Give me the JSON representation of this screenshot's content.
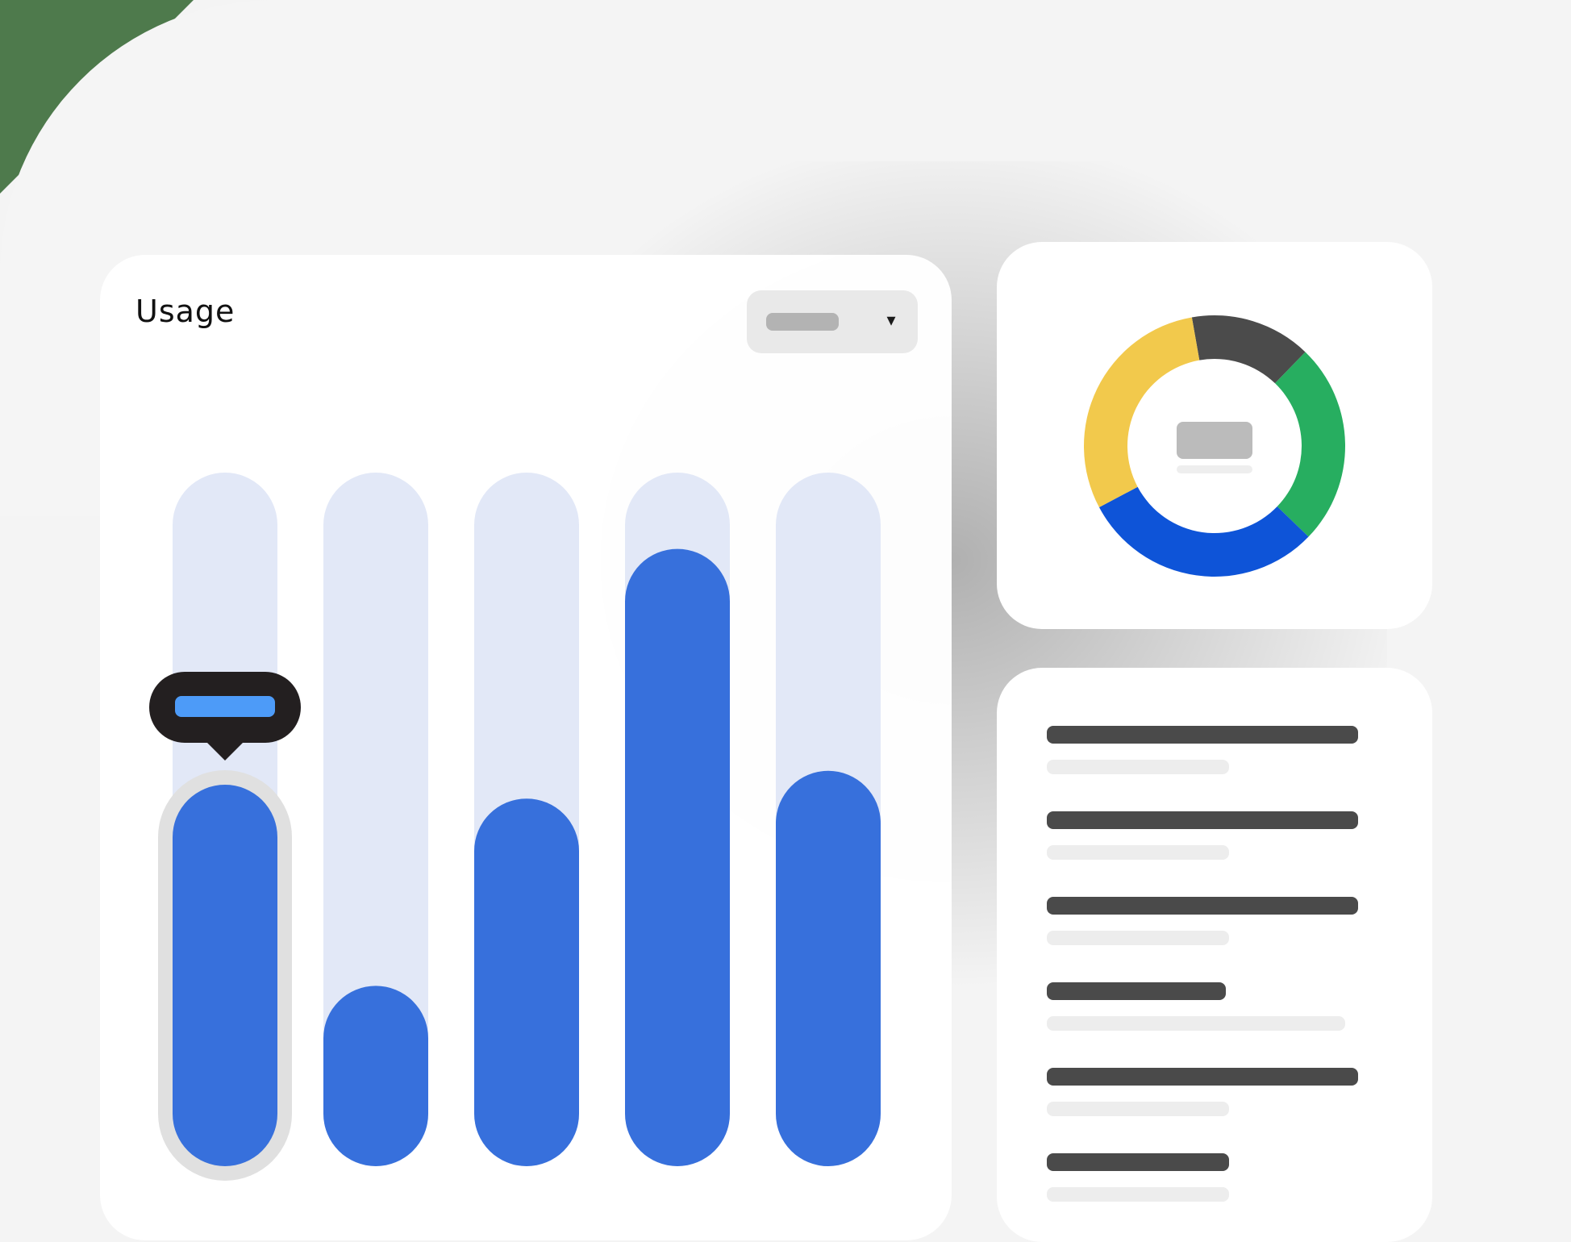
{
  "usage_card": {
    "title": "Usage"
  },
  "colors": {
    "bar": "#3770dc",
    "track": "#e2e8f7",
    "tooltip_bg": "#231f20",
    "tooltip_fill": "#4d9bf8",
    "donut_yellow": "#f2c94c",
    "donut_dark": "#4b4b4b",
    "donut_green": "#27ae60",
    "donut_blue": "#0e54d8"
  },
  "chart_data": {
    "type": "bar",
    "categories": [
      "",
      "",
      "",
      "",
      ""
    ],
    "values": [
      55,
      26,
      53,
      89,
      57
    ],
    "ylim": [
      0,
      100
    ],
    "selected_index": 0,
    "grid": false
  },
  "donut": {
    "type": "pie",
    "slices": [
      {
        "color": "#4b4b4b",
        "value": 15
      },
      {
        "color": "#27ae60",
        "value": 25
      },
      {
        "color": "#0e54d8",
        "value": 30
      },
      {
        "color": "#f2c94c",
        "value": 30
      }
    ]
  },
  "list": {
    "rows": 6
  },
  "icons": {
    "dropdown": "chevron-down-icon"
  }
}
